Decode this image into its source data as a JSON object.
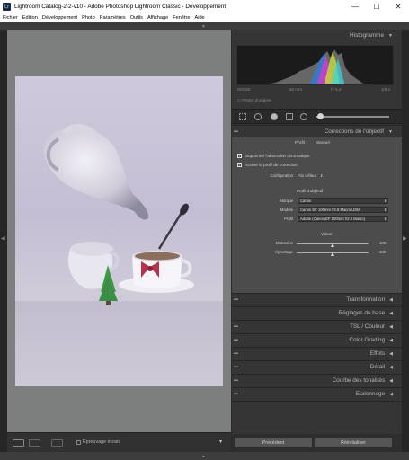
{
  "window": {
    "title": "Lightroom Catalog-2-2-v10 - Adobe Photoshop Lightroom Classic - Développement",
    "app_icon": "Lr",
    "minimize": "—",
    "maximize": "☐",
    "close": "✕"
  },
  "menu": [
    "Fichier",
    "Edition",
    "Développement",
    "Photo",
    "Paramètres",
    "Outils",
    "Affichage",
    "Fenêtre",
    "Aide"
  ],
  "histogram": {
    "title": "Histogramme",
    "info": [
      "ISO 50",
      "50 mm",
      "f / 6,3",
      "1/8 s"
    ],
    "original_label": "Photo d'origine"
  },
  "lens_panel": {
    "title": "Corrections de l'objectif",
    "tabs": [
      "Profil",
      "Manuel"
    ],
    "chromatic": "Supprimer l'aberration chromatique",
    "enable_profile": "Activer le profil de correction",
    "config_label": "Configuration",
    "config_value": "Par défaut",
    "lens_profile_title": "Profil d'objectif",
    "make_label": "Marque",
    "make_value": "Canon",
    "model_label": "Modèle",
    "model_value": "Canon EF 100mm f/2.8 Macro USM",
    "profile_label": "Profil",
    "profile_value": "Adobe (Canon EF 100mm f/2.8 Macro)",
    "amount_title": "Valeur",
    "distortion_label": "Distorsion",
    "distortion_value": "100",
    "vignetting_label": "Vignettage",
    "vignetting_value": "100"
  },
  "panels": [
    {
      "label": "Transformation"
    },
    {
      "label": "Réglages de base"
    },
    {
      "label": "TSL / Couleur"
    },
    {
      "label": "Color Grading"
    },
    {
      "label": "Effets"
    },
    {
      "label": "Détail"
    },
    {
      "label": "Courbe des tonalités"
    },
    {
      "label": "Etalonnage"
    }
  ],
  "toolbar": {
    "soft_proof": "Epreuvage écran"
  },
  "buttons": {
    "previous": "Précédent",
    "reset": "Réinitialiser"
  },
  "colors": {
    "panel_bg": "#353535",
    "lens_active_bg": "#4c4c4c",
    "canvas_bg": "#7d7f7f",
    "photo_tint": "#c8c3d8"
  }
}
